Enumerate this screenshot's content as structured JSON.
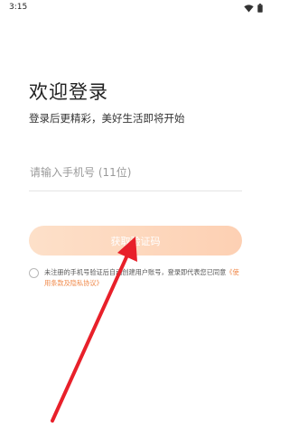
{
  "status_bar": {
    "time": "3:15",
    "icons": [
      "wifi-icon",
      "battery-icon"
    ]
  },
  "login": {
    "title": "欢迎登录",
    "subtitle": "登录后更精彩，美好生活即将开始",
    "phone_placeholder": "请输入手机号 (11位)",
    "phone_value": "",
    "get_code_label": "获取验证码",
    "agreement_text": "未注册的手机号验证后自动创建用户账号，登录即代表您已同意",
    "terms_link": "《使用条款及隐私协议》"
  },
  "colors": {
    "accent": "#f08a4b",
    "button_bg": "#fdd9c2",
    "annotation_arrow": "#e8202a"
  }
}
